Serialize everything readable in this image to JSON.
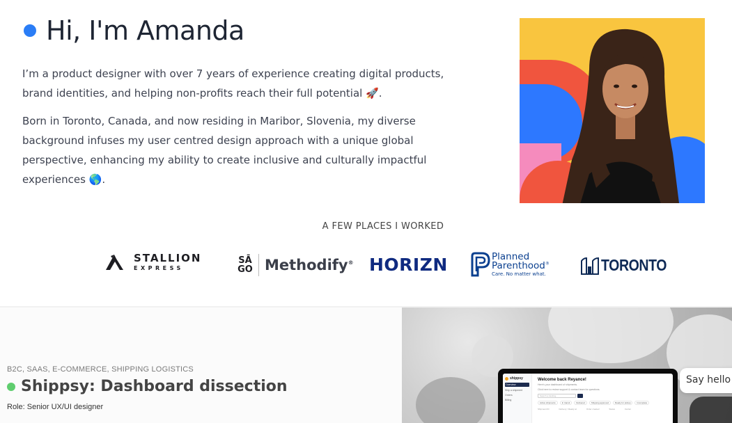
{
  "intro": {
    "greeting": "Hi, I'm Amanda",
    "paragraph_1": "I’m a product designer with over 7 years of experience creating digital products, brand identities, and helping non-profits reach their full potential",
    "paragraph_1_emoji": "🚀",
    "paragraph_1_end": ".",
    "paragraph_2": "Born in Toronto, Canada, and now residing in Maribor, Slovenia, my diverse background infuses my user centred design approach with a unique global perspective, enhancing my ability to create inclusive and culturally impactful experiences",
    "paragraph_2_emoji": "🌎",
    "paragraph_2_end": ".",
    "accent_color": "#2a7df6"
  },
  "workplaces": {
    "heading": "A FEW PLACES I WORKED",
    "logos": {
      "stallion_main": "STALLION",
      "stallion_sub": "EXPRESS",
      "sago": "SĀ",
      "sago_2": "GO",
      "methodify": "Methodify",
      "methodify_tm": "®",
      "horizn": "HORIZN",
      "planned_1": "Planned",
      "planned_2": "Parenthood",
      "planned_tm": "®",
      "planned_tagline": "Care. No matter what.",
      "toronto": "TORONTO"
    }
  },
  "project": {
    "tags": "B2C, SAAS, E-COMMERCE, SHIPPING LOGISTICS",
    "title": "Shippsy: Dashboard dissection",
    "role": "Role: Senior UX/UI designer",
    "status_color": "#5fcd6e",
    "preview": {
      "brand": "shippsy",
      "nav_1": "Overview",
      "nav_2": "Ship a shipment",
      "nav_3": "Orders",
      "nav_4": "Billing",
      "welcome": "Welcome back Reyance!",
      "sub_1": "Here's your dashboard of shipments.",
      "sub_2": "Click here to review support & contact team for questions.",
      "search_placeholder": "Search a tracking",
      "chip_1": "Active shipments",
      "chip_2": "In transit",
      "chip_3": "Delivered",
      "chip_4": "Shipping approved",
      "chip_5": "Ready for pickup",
      "chip_6": "Incomplete",
      "col_1": "Shipment ID",
      "col_2": "Delivery / Ready at",
      "col_3": "Order created",
      "col_4": "Status",
      "col_5": "Carrier"
    }
  },
  "chat": {
    "say_hello": "Say hello"
  }
}
